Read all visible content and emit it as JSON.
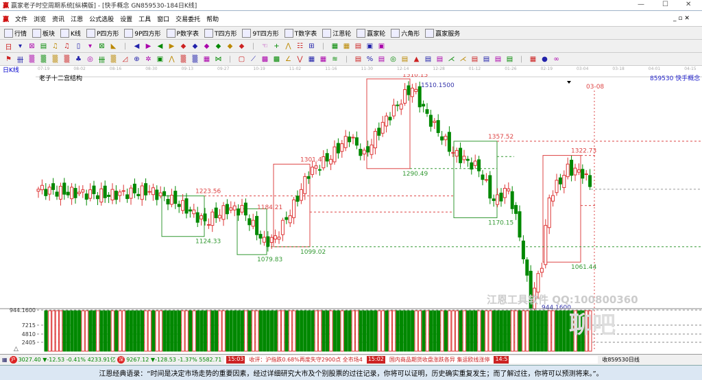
{
  "window": {
    "title": "赢家老子时空周期系统[纵横版] - [快手概念  GN859530-184日K线]",
    "min": "—",
    "max": "☐",
    "close": "✕"
  },
  "menu": [
    "文件",
    "浏览",
    "资讯",
    "江恩",
    "公式选股",
    "设置",
    "工具",
    "窗口",
    "交易委托",
    "帮助"
  ],
  "toolbar": [
    {
      "icon": "grid-icon",
      "label": "行情"
    },
    {
      "icon": "blocks-icon",
      "label": "板块"
    },
    {
      "icon": "candle-icon",
      "label": "K线"
    },
    {
      "icon": "P4-icon",
      "label": "P四方形"
    },
    {
      "icon": "P9-icon",
      "label": "9P四方形"
    },
    {
      "icon": "PN-icon",
      "label": "P数字表"
    },
    {
      "icon": "T4-icon",
      "label": "T四方形"
    },
    {
      "icon": "T9-icon",
      "label": "9T四方形"
    },
    {
      "icon": "TN-icon",
      "label": "T数字表"
    },
    {
      "icon": "wheel-icon",
      "label": "江恩轮"
    },
    {
      "icon": "winner-wheel-icon",
      "label": "赢家轮"
    },
    {
      "icon": "hexagon-icon",
      "label": "六角形"
    },
    {
      "icon": "dollar-icon",
      "label": "赢家服务"
    }
  ],
  "period_label": "日K线",
  "dates": [
    "07-19",
    "08-02",
    "08-16",
    "08-30",
    "09-13",
    "09-27",
    "10-19",
    "11-02",
    "11-16",
    "11-30",
    "12-14",
    "12-28",
    "01-12",
    "01-26",
    "02-19",
    "03-04",
    "03-18",
    "04-01",
    "04-15"
  ],
  "chart_title": "老子十二宫结构",
  "symbol_label": "859530 快手概念",
  "marker_date": "03-08",
  "watermark": "江恩工具软件  QQ:100800360",
  "watermark2": "聊吧",
  "chart_data": {
    "type": "candlestick",
    "ylim": [
      944.16,
      1510.15
    ],
    "close_anchors": [
      [
        0,
        1240
      ],
      [
        8,
        1232
      ],
      [
        19,
        1226
      ],
      [
        30,
        1236
      ],
      [
        38,
        1205
      ],
      [
        45,
        1160
      ],
      [
        51,
        1192
      ],
      [
        55,
        1190
      ],
      [
        61,
        1110
      ],
      [
        64,
        1120
      ],
      [
        69,
        1200
      ],
      [
        73,
        1280
      ],
      [
        79,
        1320
      ],
      [
        84,
        1370
      ],
      [
        88,
        1322
      ],
      [
        93,
        1400
      ],
      [
        99,
        1470
      ],
      [
        101,
        1490
      ],
      [
        105,
        1420
      ],
      [
        112,
        1330
      ],
      [
        119,
        1290
      ],
      [
        123,
        1210
      ],
      [
        127,
        1240
      ],
      [
        130,
        1130
      ],
      [
        133,
        960
      ],
      [
        136,
        1060
      ],
      [
        138,
        1220
      ],
      [
        143,
        1290
      ],
      [
        147,
        1280
      ],
      [
        149,
        1250
      ]
    ],
    "price_labels": [
      "1510.15",
      "1510.1500",
      "1357.52",
      "1322.73",
      "1301.40",
      "1290.49",
      "1223.56",
      "1184.21",
      "1170.15",
      "1124.33",
      "1099.02",
      "1079.83",
      "1061.44",
      "944.1600"
    ],
    "volume_axis": [
      "944.1600",
      "7215",
      "4810",
      "2405"
    ]
  },
  "status": {
    "sh_index": "3027.40",
    "sh_change": "▼-12.53",
    "sh_pct": "-0.41%",
    "sh_amount": "4233.91亿",
    "sz_index": "9267.12",
    "sz_change": "▼-128.53",
    "sz_pct": "-1.37%",
    "sz_amount": "5582.71",
    "news_time1": "15:03",
    "news1": "收评：沪指跌0.68%再度失守2900点 全市场4",
    "news_time2": "15:02",
    "news2": "国内商品期货收盘涨跌各异 集运欧线涨停",
    "news_time3": "14:5",
    "right": "收859530日线"
  },
  "quote": "江恩经典语录：“时间是决定市场走势的重要因素，经过详细研究大市及个别股票的过往记录，你将可以证明，历史确实重复发生；而了解过往，你将可以预测将来。”。"
}
